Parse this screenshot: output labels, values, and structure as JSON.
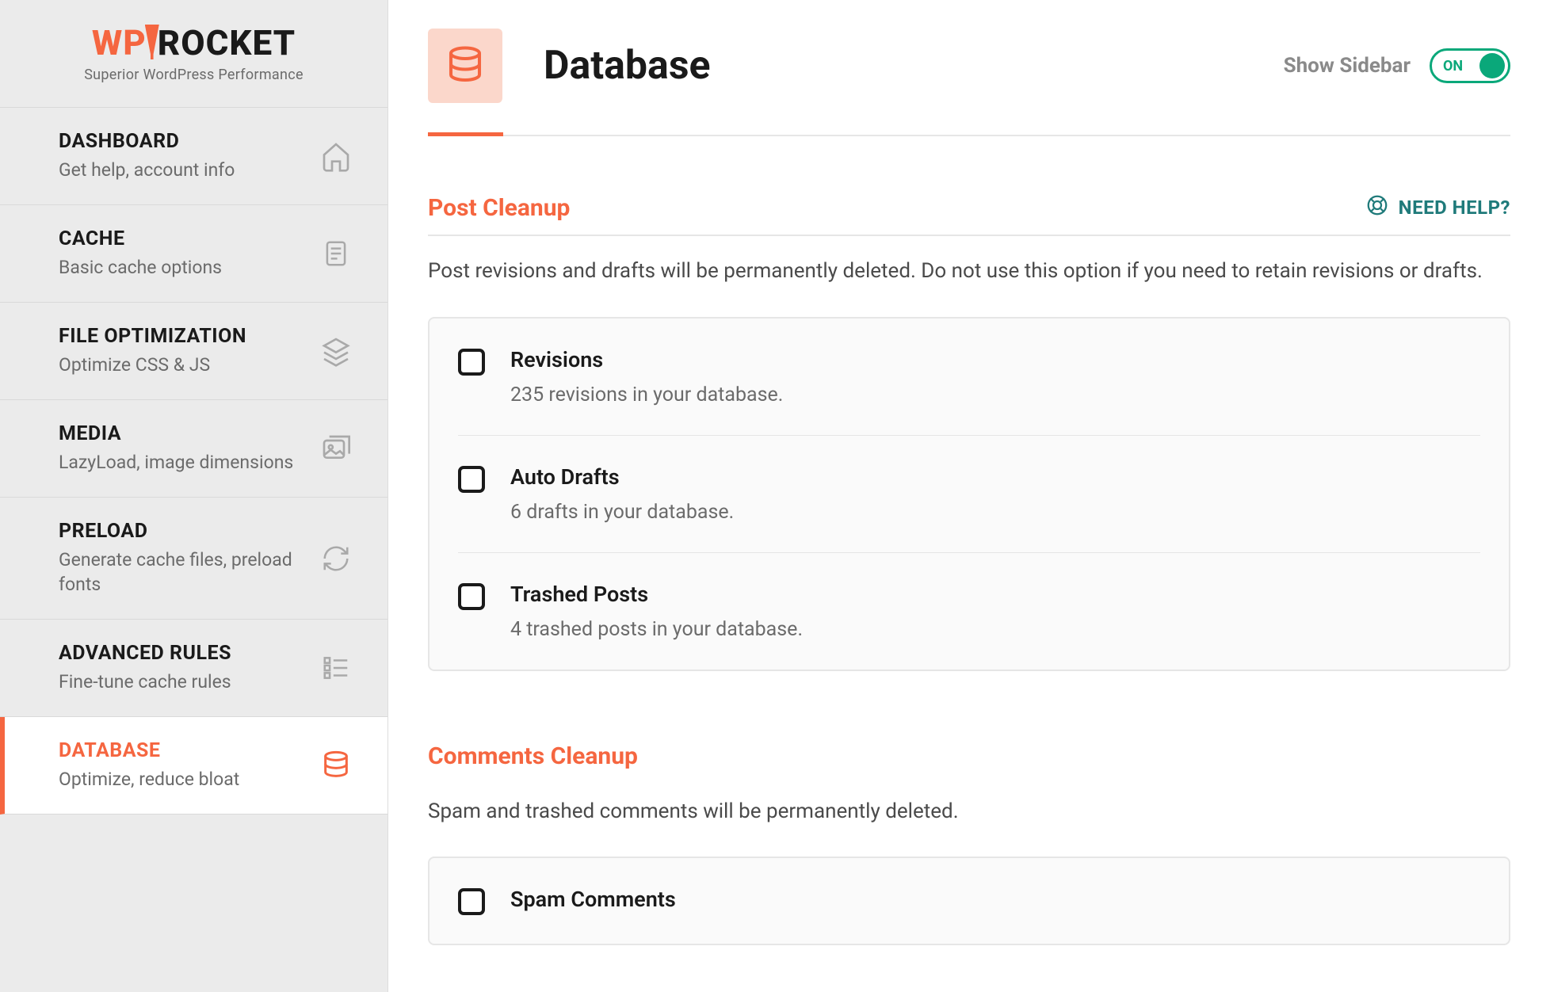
{
  "logo": {
    "wp": "WP",
    "rocket": "ROCKET",
    "tagline": "Superior WordPress Performance"
  },
  "nav": [
    {
      "title": "DASHBOARD",
      "sub": "Get help, account info",
      "icon": "home"
    },
    {
      "title": "CACHE",
      "sub": "Basic cache options",
      "icon": "doc"
    },
    {
      "title": "FILE OPTIMIZATION",
      "sub": "Optimize CSS & JS",
      "icon": "layers"
    },
    {
      "title": "MEDIA",
      "sub": "LazyLoad, image dimensions",
      "icon": "images"
    },
    {
      "title": "PRELOAD",
      "sub": "Generate cache files, preload fonts",
      "icon": "refresh"
    },
    {
      "title": "ADVANCED RULES",
      "sub": "Fine-tune cache rules",
      "icon": "list"
    },
    {
      "title": "DATABASE",
      "sub": "Optimize, reduce bloat",
      "icon": "database",
      "active": true
    }
  ],
  "header": {
    "title": "Database",
    "show_sidebar": "Show Sidebar",
    "toggle": "ON"
  },
  "help": {
    "label": "NEED HELP?"
  },
  "sections": {
    "post": {
      "title": "Post Cleanup",
      "desc": "Post revisions and drafts will be permanently deleted. Do not use this option if you need to retain revisions or drafts.",
      "options": [
        {
          "title": "Revisions",
          "sub": "235 revisions in your database."
        },
        {
          "title": "Auto Drafts",
          "sub": "6 drafts in your database."
        },
        {
          "title": "Trashed Posts",
          "sub": "4 trashed posts in your database."
        }
      ]
    },
    "comments": {
      "title": "Comments Cleanup",
      "desc": "Spam and trashed comments will be permanently deleted.",
      "options": [
        {
          "title": "Spam Comments",
          "sub": ""
        }
      ]
    }
  }
}
